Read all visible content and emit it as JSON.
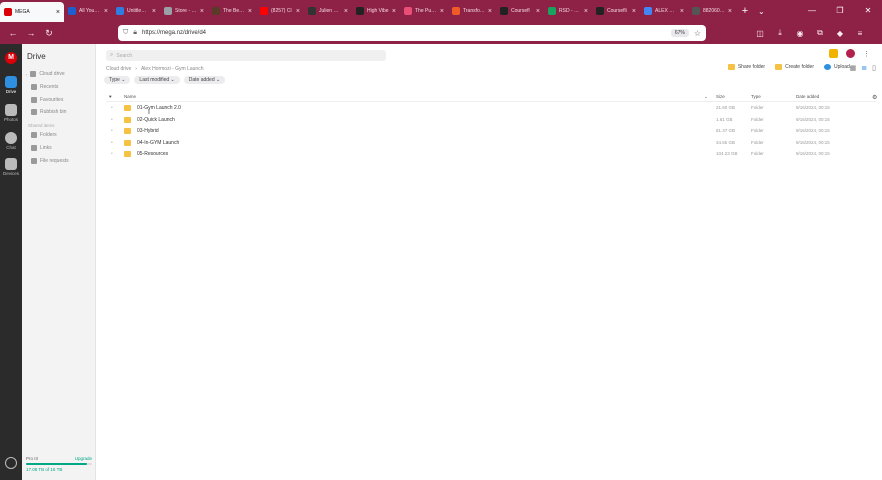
{
  "browser": {
    "tabs": [
      {
        "label": "MEGA",
        "active": true,
        "color": "#d90007"
      },
      {
        "label": "All Your Dr",
        "active": false,
        "color": "#1d5fd1"
      },
      {
        "label": "Untitled de",
        "active": false,
        "color": "#2f7de1"
      },
      {
        "label": "Store - Thr",
        "active": false,
        "color": "#9aa0a6"
      },
      {
        "label": "The Bedroo",
        "active": false,
        "color": "#5a3b2a"
      },
      {
        "label": "(8257) Cl",
        "active": false,
        "color": "#ff0000"
      },
      {
        "label": "Julien Blanc",
        "active": false,
        "color": "#333333"
      },
      {
        "label": "High Vibe",
        "active": false,
        "color": "#222222"
      },
      {
        "label": "The Purpos",
        "active": false,
        "color": "#e94e77"
      },
      {
        "label": "Transform",
        "active": false,
        "color": "#f05a28"
      },
      {
        "label": "Coursefl",
        "active": false,
        "color": "#222222"
      },
      {
        "label": "RSD - PTG",
        "active": false,
        "color": "#1aa260"
      },
      {
        "label": "Coursefli",
        "active": false,
        "color": "#222222"
      },
      {
        "label": "ALEX HOR",
        "active": false,
        "color": "#4285f4"
      },
      {
        "label": "8820604_5de51",
        "active": false,
        "color": "#555555"
      }
    ],
    "url": "https://mega.nz/drive/d4",
    "zoom": "67%"
  },
  "rail": {
    "items": [
      {
        "label": "Drive",
        "icon": "folder-icon"
      },
      {
        "label": "Photos",
        "icon": "photo-icon"
      },
      {
        "label": "Chat",
        "icon": "chat-icon"
      },
      {
        "label": "Devices",
        "icon": "device-icon"
      }
    ]
  },
  "sidebar": {
    "title": "Drive",
    "items": [
      "Cloud drive",
      "Recents",
      "Favourites",
      "Rubbish bin"
    ],
    "section_label": "Shared items",
    "shared_items": [
      "Folders",
      "Links",
      "File requests"
    ],
    "storage": {
      "plan": "Pro III",
      "upgrade": "Upgrade",
      "used_label": "17.08 TB of 16 TB",
      "fraction": 0.92
    }
  },
  "main": {
    "search_placeholder": "Search",
    "breadcrumb": [
      "Cloud drive",
      "›",
      "Alex Hormozi - Gym Launch"
    ],
    "filters": [
      "Type ⌄",
      "Last modified ⌄",
      "Date added ⌄"
    ],
    "actions": {
      "share": "Share folder",
      "create": "Create folder",
      "upload": "Upload..."
    },
    "columns": {
      "name": "Name",
      "size": "Size",
      "type": "Type",
      "date": "Date added"
    },
    "rows": [
      {
        "name": "01-Gym Launch 2.0",
        "size": "21.60 GB",
        "type": "Folder",
        "date": "9/16/2024, 00:15"
      },
      {
        "name": "02-Quick Launch",
        "size": "1.61 GB",
        "type": "Folder",
        "date": "9/16/2024, 00:15"
      },
      {
        "name": "03-Hybrid",
        "size": "61.37 GB",
        "type": "Folder",
        "date": "9/16/2024, 00:15"
      },
      {
        "name": "04-In-GYM Launch",
        "size": "34.65 GB",
        "type": "Folder",
        "date": "9/16/2024, 00:15"
      },
      {
        "name": "05-Resources",
        "size": "104.23 GB",
        "type": "Folder",
        "date": "9/16/2024, 00:15"
      }
    ]
  }
}
